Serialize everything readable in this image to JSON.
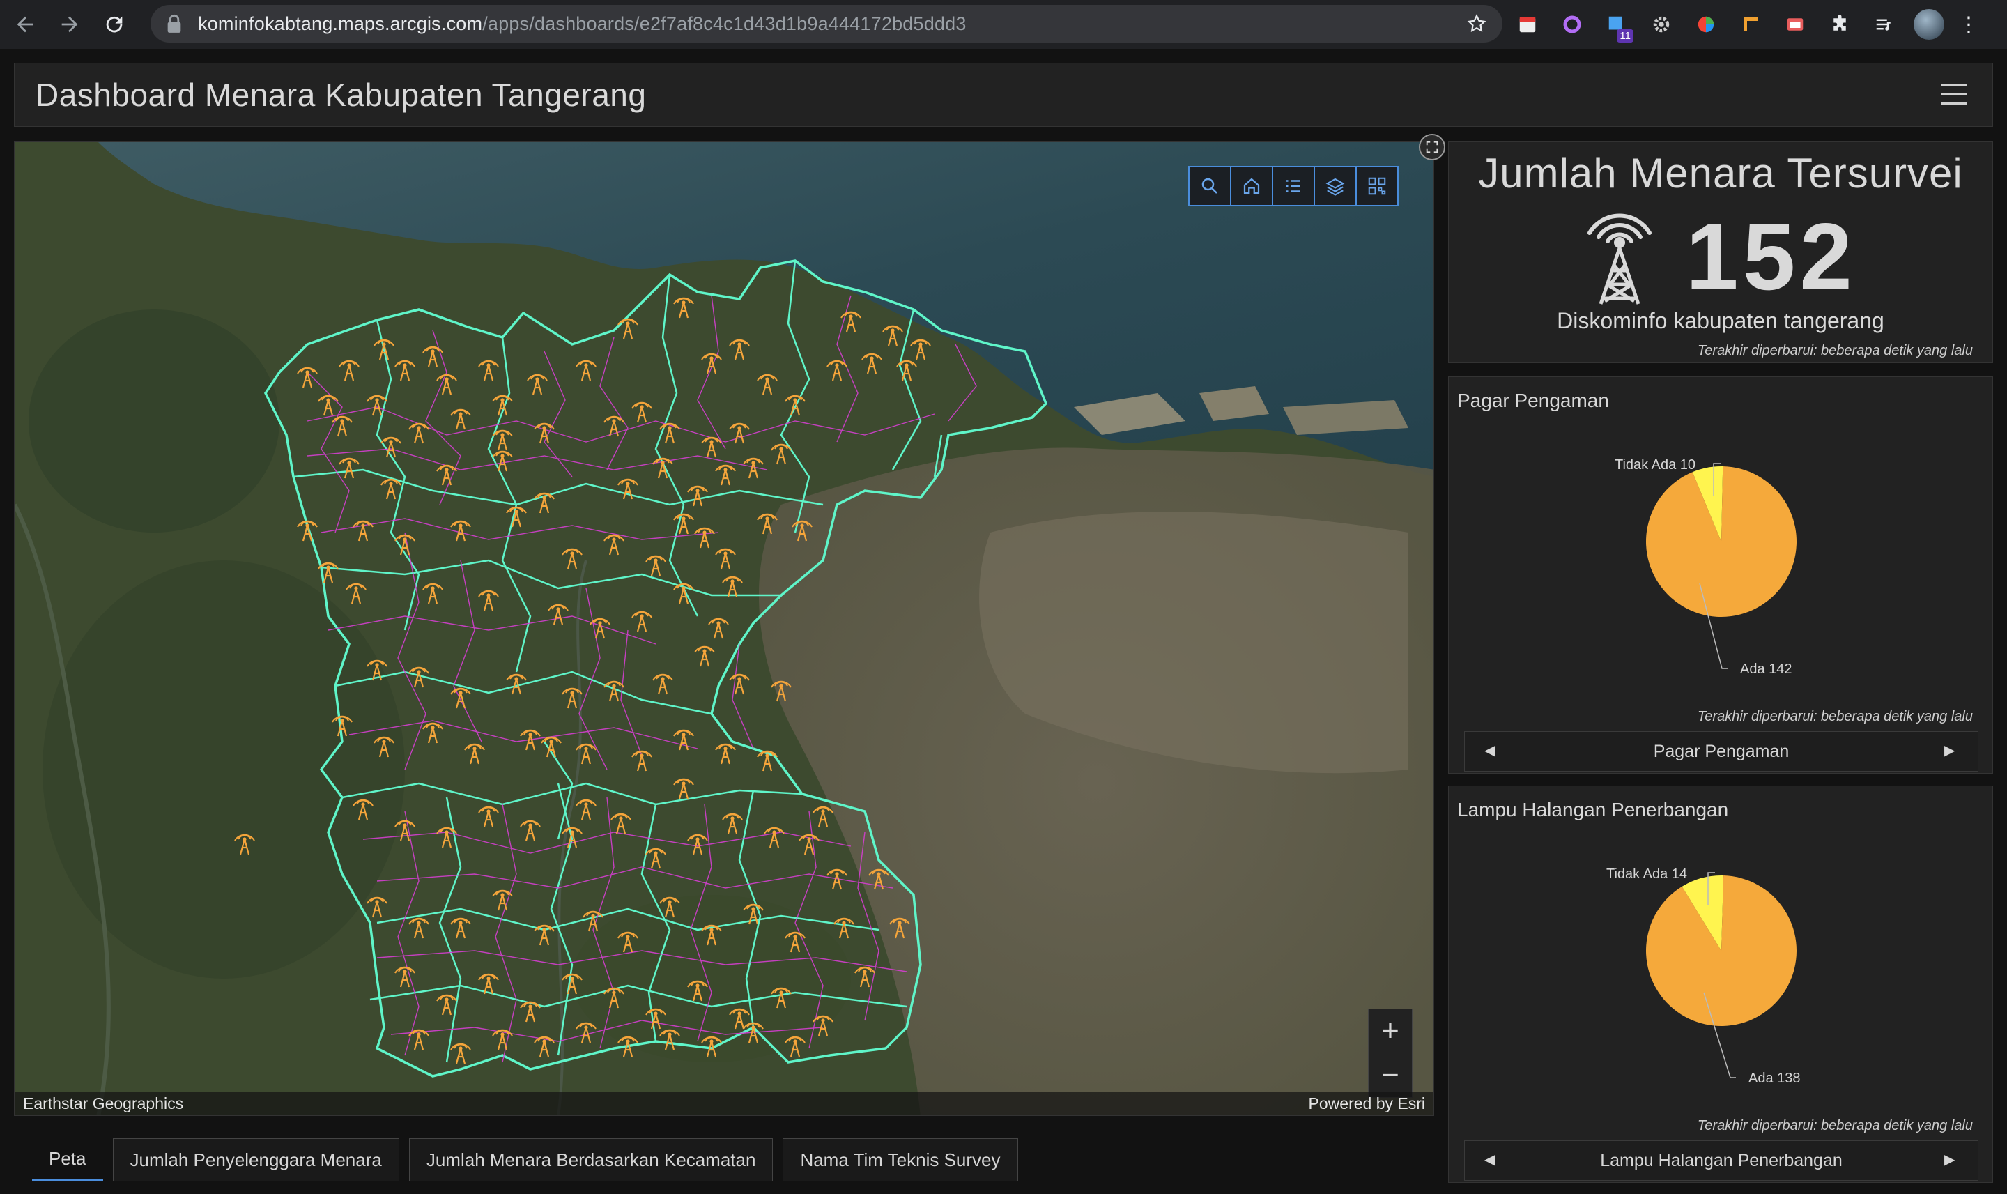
{
  "browser": {
    "url_host": "kominfokabtang.maps.arcgis.com",
    "url_path": "/apps/dashboards/e2f7af8c4c1d43d1b9a444172bd5ddd3",
    "extension_badge": "11"
  },
  "header": {
    "title": "Dashboard Menara Kabupaten Tangerang"
  },
  "map": {
    "attribution_left": "Earthstar Geographics",
    "attribution_right": "Powered by Esri",
    "tools": [
      "search-icon",
      "home-icon",
      "list-icon",
      "layers-icon",
      "qr-icon"
    ],
    "zoom_in": "+",
    "zoom_out": "−",
    "colors": {
      "boundary": "#5ff5c9",
      "village": "#d43fd0",
      "marker": "#f5a53b"
    }
  },
  "tabs": [
    {
      "label": "Peta"
    },
    {
      "label": "Jumlah Penyelenggara Menara"
    },
    {
      "label": "Jumlah Menara Berdasarkan Kecamatan"
    },
    {
      "label": "Nama Tim Teknis Survey"
    }
  ],
  "indicator": {
    "title": "Jumlah Menara Tersurvei",
    "value": "152",
    "subtitle": "Diskominfo kabupaten tangerang",
    "updated": "Terakhir diperbarui: beberapa detik yang lalu"
  },
  "pies": [
    {
      "title": "Pagar Pengaman",
      "label_small": "Tidak Ada 10",
      "label_large": "Ada 142",
      "updated": "Terakhir diperbarui: beberapa detik yang lalu",
      "selector": "Pagar Pengaman"
    },
    {
      "title": "Lampu Halangan Penerbangan",
      "label_small": "Tidak Ada 14",
      "label_large": "Ada 138",
      "updated": "Terakhir diperbarui: beberapa detik yang lalu",
      "selector": "Lampu Halangan Penerbangan"
    }
  ],
  "chart_data": [
    {
      "type": "pie",
      "title": "Pagar Pengaman",
      "categories": [
        "Tidak Ada",
        "Ada"
      ],
      "values": [
        10,
        142
      ],
      "colors": [
        "#fff44f",
        "#f5a93b"
      ]
    },
    {
      "type": "pie",
      "title": "Lampu Halangan Penerbangan",
      "categories": [
        "Tidak Ada",
        "Ada"
      ],
      "values": [
        14,
        138
      ],
      "colors": [
        "#fff44f",
        "#f5a93b"
      ]
    }
  ]
}
